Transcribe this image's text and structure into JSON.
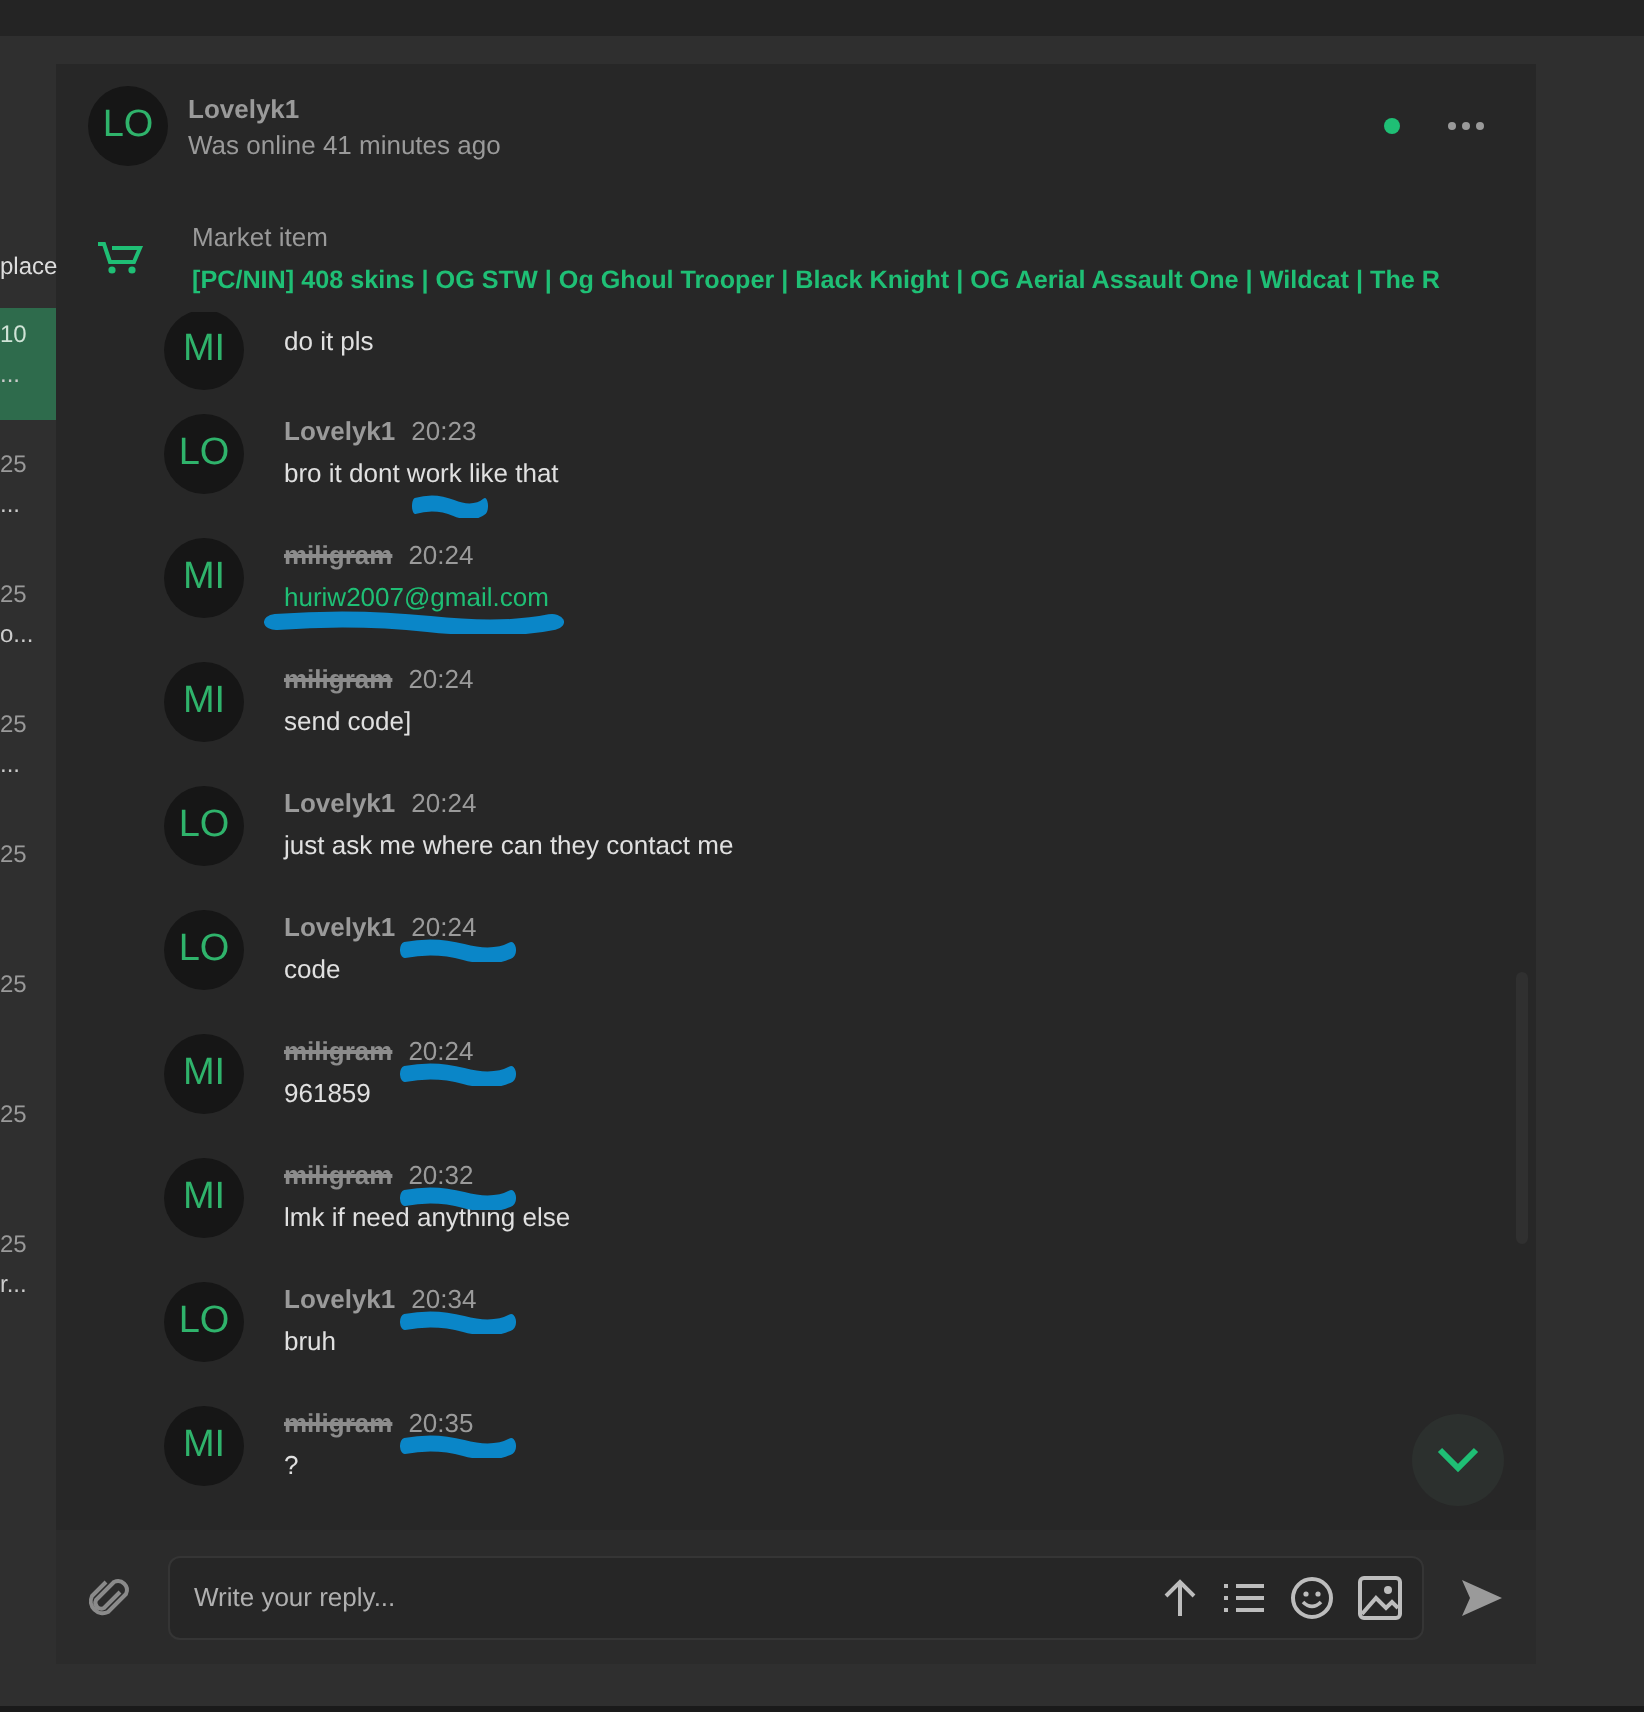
{
  "sidebar": {
    "fragment": "place",
    "items": [
      {
        "time": "10",
        "preview": "...",
        "selected": true
      },
      {
        "time": "25",
        "preview": "...",
        "selected": false
      },
      {
        "time": "25",
        "preview": "o...",
        "selected": false
      },
      {
        "time": "25",
        "preview": "...",
        "selected": false
      },
      {
        "time": "25",
        "selected": false
      },
      {
        "time": "25",
        "selected": false
      },
      {
        "time": "25",
        "selected": false
      },
      {
        "time": "25",
        "preview": "r...",
        "selected": false
      }
    ]
  },
  "chat": {
    "avatar": "LO",
    "name": "Lovelyk1",
    "status": "Was online 41 minutes ago",
    "online": true
  },
  "market_item": {
    "label": "Market item",
    "title": "[PC/NIN] 408 skins | OG STW | Og Ghoul Trooper | Black Knight | OG Aerial Assault One | Wildcat | The R"
  },
  "messages": [
    {
      "avatar": "MI",
      "text": "do it pls",
      "kind": "text"
    },
    {
      "avatar": "LO",
      "author": "Lovelyk1",
      "time": "20:23",
      "text": "bro it dont work like that",
      "kind": "text",
      "banned": false,
      "scribble": {
        "kind": "below"
      }
    },
    {
      "avatar": "MI",
      "author": "miligram",
      "time": "20:24",
      "text": "huriw2007@gmail.com",
      "kind": "link",
      "banned": true,
      "scribble": {
        "kind": "under-text"
      }
    },
    {
      "avatar": "MI",
      "author": "miligram",
      "time": "20:24",
      "text": "send code]",
      "kind": "text",
      "banned": true
    },
    {
      "avatar": "LO",
      "author": "Lovelyk1",
      "time": "20:24",
      "text": "just ask me where can they contact me",
      "kind": "text",
      "banned": false
    },
    {
      "avatar": "LO",
      "author": "Lovelyk1",
      "time": "20:24",
      "text": "code",
      "kind": "text",
      "banned": false,
      "scribble": {
        "kind": "time"
      }
    },
    {
      "avatar": "MI",
      "author": "miligram",
      "time": "20:24",
      "text": "961859",
      "kind": "text",
      "banned": true,
      "scribble": {
        "kind": "time"
      }
    },
    {
      "avatar": "MI",
      "author": "miligram",
      "time": "20:32",
      "text": "lmk if need anything else",
      "kind": "text",
      "banned": true,
      "scribble": {
        "kind": "time"
      }
    },
    {
      "avatar": "LO",
      "author": "Lovelyk1",
      "time": "20:34",
      "text": "bruh",
      "kind": "text",
      "banned": false,
      "scribble": {
        "kind": "time"
      }
    },
    {
      "avatar": "MI",
      "author": "miligram",
      "time": "20:35",
      "text": "?",
      "kind": "text",
      "banned": true,
      "scribble": {
        "kind": "time"
      }
    }
  ],
  "composer": {
    "placeholder": "Write your reply..."
  }
}
